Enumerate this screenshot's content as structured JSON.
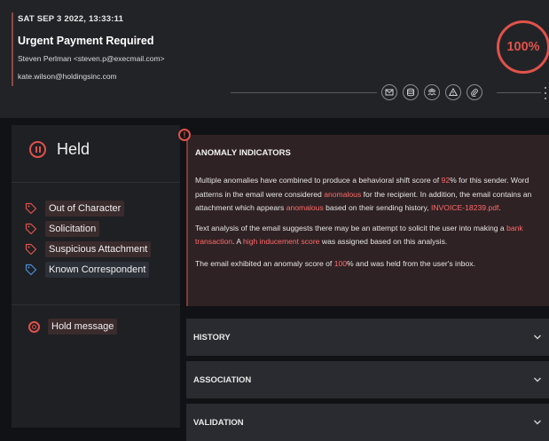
{
  "email": {
    "date": "SAT SEP 3 2022, 13:33:11",
    "subject": "Urgent Payment Required",
    "from": "Steven Perlman <steven.p@execmail.com>",
    "to": "kate.wilson@holdingsinc.com",
    "score": "100%"
  },
  "toolbar_icons": [
    "envelope-icon",
    "database-icon",
    "users-icon",
    "warning-icon",
    "paperclip-icon"
  ],
  "status": {
    "label": "Held",
    "tags": [
      {
        "label": "Out of Character",
        "color": "#e0524a"
      },
      {
        "label": "Solicitation",
        "color": "#e0524a"
      },
      {
        "label": "Suspicious Attachment",
        "color": "#e0524a"
      },
      {
        "label": "Known Correspondent",
        "color": "#4a90d9"
      }
    ],
    "action": "Hold message"
  },
  "anomaly": {
    "title": "ANOMALY INDICATORS",
    "p1": {
      "a": "Multiple anomalies have combined to produce a behavioral shift score of ",
      "score": "92",
      "b": "% for this sender. Word patterns in the email were considered ",
      "anom1": "anomalous",
      "c": " for the recipient. In addition, the email contains an attachment which appears ",
      "anom2": "anomalous",
      "d": " based on their sending history, ",
      "file": "INVOICE-18239.pdf",
      "e": "."
    },
    "p2": {
      "a": "Text analysis of the email suggests there may be an attempt to solicit the user into making a ",
      "bank": "bank transaction",
      "b": ". A ",
      "induce": "high inducement score",
      "c": " was assigned based on this analysis."
    },
    "p3": {
      "a": "The email exhibited an anomaly score of ",
      "score": "100",
      "b": "% and was held from the user's inbox."
    }
  },
  "sections": {
    "history": "HISTORY",
    "association": "ASSOCIATION",
    "validation": "VALIDATION"
  },
  "colors": {
    "accent_red": "#e0524a",
    "highlight_red": "#ff6a6a",
    "known_blue": "#4a90d9"
  }
}
